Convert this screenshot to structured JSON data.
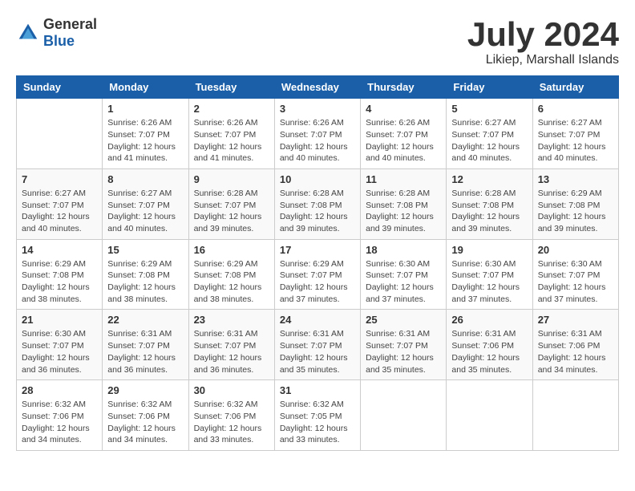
{
  "logo": {
    "general": "General",
    "blue": "Blue"
  },
  "title": "July 2024",
  "subtitle": "Likiep, Marshall Islands",
  "days_of_week": [
    "Sunday",
    "Monday",
    "Tuesday",
    "Wednesday",
    "Thursday",
    "Friday",
    "Saturday"
  ],
  "weeks": [
    [
      {
        "day": "",
        "info": ""
      },
      {
        "day": "1",
        "info": "Sunrise: 6:26 AM\nSunset: 7:07 PM\nDaylight: 12 hours\nand 41 minutes."
      },
      {
        "day": "2",
        "info": "Sunrise: 6:26 AM\nSunset: 7:07 PM\nDaylight: 12 hours\nand 41 minutes."
      },
      {
        "day": "3",
        "info": "Sunrise: 6:26 AM\nSunset: 7:07 PM\nDaylight: 12 hours\nand 40 minutes."
      },
      {
        "day": "4",
        "info": "Sunrise: 6:26 AM\nSunset: 7:07 PM\nDaylight: 12 hours\nand 40 minutes."
      },
      {
        "day": "5",
        "info": "Sunrise: 6:27 AM\nSunset: 7:07 PM\nDaylight: 12 hours\nand 40 minutes."
      },
      {
        "day": "6",
        "info": "Sunrise: 6:27 AM\nSunset: 7:07 PM\nDaylight: 12 hours\nand 40 minutes."
      }
    ],
    [
      {
        "day": "7",
        "info": "Sunrise: 6:27 AM\nSunset: 7:07 PM\nDaylight: 12 hours\nand 40 minutes."
      },
      {
        "day": "8",
        "info": "Sunrise: 6:27 AM\nSunset: 7:07 PM\nDaylight: 12 hours\nand 40 minutes."
      },
      {
        "day": "9",
        "info": "Sunrise: 6:28 AM\nSunset: 7:07 PM\nDaylight: 12 hours\nand 39 minutes."
      },
      {
        "day": "10",
        "info": "Sunrise: 6:28 AM\nSunset: 7:08 PM\nDaylight: 12 hours\nand 39 minutes."
      },
      {
        "day": "11",
        "info": "Sunrise: 6:28 AM\nSunset: 7:08 PM\nDaylight: 12 hours\nand 39 minutes."
      },
      {
        "day": "12",
        "info": "Sunrise: 6:28 AM\nSunset: 7:08 PM\nDaylight: 12 hours\nand 39 minutes."
      },
      {
        "day": "13",
        "info": "Sunrise: 6:29 AM\nSunset: 7:08 PM\nDaylight: 12 hours\nand 39 minutes."
      }
    ],
    [
      {
        "day": "14",
        "info": "Sunrise: 6:29 AM\nSunset: 7:08 PM\nDaylight: 12 hours\nand 38 minutes."
      },
      {
        "day": "15",
        "info": "Sunrise: 6:29 AM\nSunset: 7:08 PM\nDaylight: 12 hours\nand 38 minutes."
      },
      {
        "day": "16",
        "info": "Sunrise: 6:29 AM\nSunset: 7:08 PM\nDaylight: 12 hours\nand 38 minutes."
      },
      {
        "day": "17",
        "info": "Sunrise: 6:29 AM\nSunset: 7:07 PM\nDaylight: 12 hours\nand 37 minutes."
      },
      {
        "day": "18",
        "info": "Sunrise: 6:30 AM\nSunset: 7:07 PM\nDaylight: 12 hours\nand 37 minutes."
      },
      {
        "day": "19",
        "info": "Sunrise: 6:30 AM\nSunset: 7:07 PM\nDaylight: 12 hours\nand 37 minutes."
      },
      {
        "day": "20",
        "info": "Sunrise: 6:30 AM\nSunset: 7:07 PM\nDaylight: 12 hours\nand 37 minutes."
      }
    ],
    [
      {
        "day": "21",
        "info": "Sunrise: 6:30 AM\nSunset: 7:07 PM\nDaylight: 12 hours\nand 36 minutes."
      },
      {
        "day": "22",
        "info": "Sunrise: 6:31 AM\nSunset: 7:07 PM\nDaylight: 12 hours\nand 36 minutes."
      },
      {
        "day": "23",
        "info": "Sunrise: 6:31 AM\nSunset: 7:07 PM\nDaylight: 12 hours\nand 36 minutes."
      },
      {
        "day": "24",
        "info": "Sunrise: 6:31 AM\nSunset: 7:07 PM\nDaylight: 12 hours\nand 35 minutes."
      },
      {
        "day": "25",
        "info": "Sunrise: 6:31 AM\nSunset: 7:07 PM\nDaylight: 12 hours\nand 35 minutes."
      },
      {
        "day": "26",
        "info": "Sunrise: 6:31 AM\nSunset: 7:06 PM\nDaylight: 12 hours\nand 35 minutes."
      },
      {
        "day": "27",
        "info": "Sunrise: 6:31 AM\nSunset: 7:06 PM\nDaylight: 12 hours\nand 34 minutes."
      }
    ],
    [
      {
        "day": "28",
        "info": "Sunrise: 6:32 AM\nSunset: 7:06 PM\nDaylight: 12 hours\nand 34 minutes."
      },
      {
        "day": "29",
        "info": "Sunrise: 6:32 AM\nSunset: 7:06 PM\nDaylight: 12 hours\nand 34 minutes."
      },
      {
        "day": "30",
        "info": "Sunrise: 6:32 AM\nSunset: 7:06 PM\nDaylight: 12 hours\nand 33 minutes."
      },
      {
        "day": "31",
        "info": "Sunrise: 6:32 AM\nSunset: 7:05 PM\nDaylight: 12 hours\nand 33 minutes."
      },
      {
        "day": "",
        "info": ""
      },
      {
        "day": "",
        "info": ""
      },
      {
        "day": "",
        "info": ""
      }
    ]
  ]
}
